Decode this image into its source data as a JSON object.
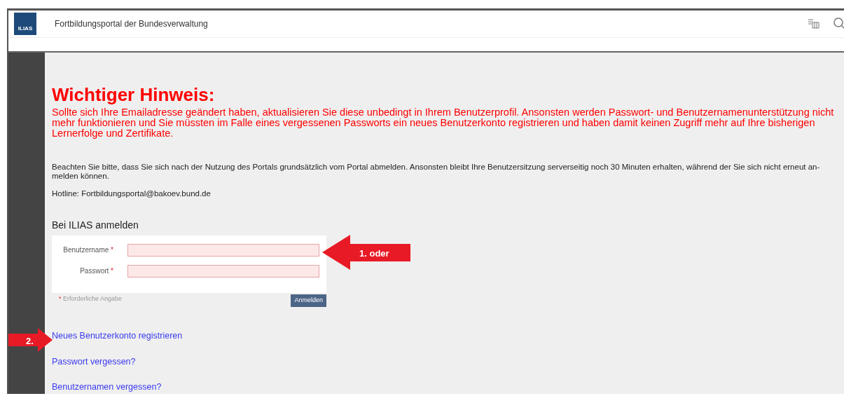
{
  "header": {
    "logo": "ILIAS",
    "title": "Fortbildungsportal der Bundesverwaltung"
  },
  "notice": {
    "heading": "Wichtiger Hinweis:",
    "text": "Sollte sich Ihre Emailadresse geändert haben, aktualisieren Sie diese unbedingt in Ihrem Benutzerprofil. Ansonsten werden Passwort- und Benutzernamenunterstützung nicht mehr funktionieren und Sie müssten im Falle eines vergessenen Passworts ein neues Benutzerkonto registrieren und haben damit keinen Zugriff mehr auf Ihre bisherigen Lernerfolge und Zertifikate."
  },
  "info": "Beachten Sie bitte, dass Sie sich nach der Nutzung des Portals grundsätzlich vom Portal abmelden. Ansonsten bleibt Ihre Benutzersitzung serverseitig noch 30 Minuten erhalten, während der Sie sich nicht erneut an-melden können.",
  "hotline": "Hotline: Fortbildungsportal@bakoev.bund.de",
  "login": {
    "title": "Bei ILIAS anmelden",
    "fields": [
      {
        "label": "Benutzername",
        "required": "*"
      },
      {
        "label": "Passwort",
        "required": "*"
      }
    ],
    "required_note": {
      "mark": "*",
      "text": "Erforderliche Angabe"
    },
    "submit": "Anmelden"
  },
  "links": [
    "Neues Benutzerkonto registrieren",
    "Passwort vergessen?",
    "Benutzernamen vergessen?"
  ],
  "annotations": [
    {
      "label": "1. oder"
    },
    {
      "label": "2."
    }
  ]
}
